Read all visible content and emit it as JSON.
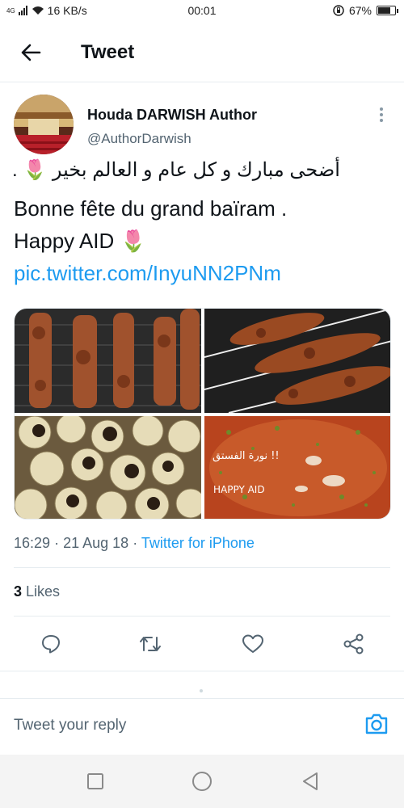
{
  "status_bar": {
    "network_label": "4G",
    "speed": "16 KB/s",
    "time": "00:01",
    "battery_percent": "67%",
    "battery_level": 0.67
  },
  "header": {
    "title": "Tweet"
  },
  "tweet": {
    "author_name": "Houda DARWISH Author",
    "author_handle": "@AuthorDarwish",
    "text_arabic": "أضحى مبارك و كل عام و العالم بخير 🌷 .",
    "text_line_french": "Bonne fête du grand baïram .",
    "text_happy": "Happy AID 🌷 ",
    "link_text": "pic.twitter.com/InyuNN2PNm",
    "photo_caption_arabic": "نورة الفستق !!",
    "photo_caption": "HAPPY AID",
    "time": "16:29",
    "date": "21 Aug 18",
    "separator": "·",
    "source": "Twitter for iPhone",
    "likes_count": "3",
    "likes_label": "Likes"
  },
  "reply": {
    "placeholder": "Tweet your reply"
  },
  "icons": {
    "back": "arrow-left-icon",
    "more": "more-vertical-icon",
    "reply": "comment-icon",
    "retweet": "retweet-icon",
    "like": "heart-icon",
    "share": "share-icon",
    "camera": "camera-icon",
    "nav_recent": "square-icon",
    "nav_home": "circle-icon",
    "nav_back": "triangle-back-icon"
  },
  "colors": {
    "accent": "#1d9bf0",
    "text": "#0f1419",
    "secondary": "#536471"
  }
}
